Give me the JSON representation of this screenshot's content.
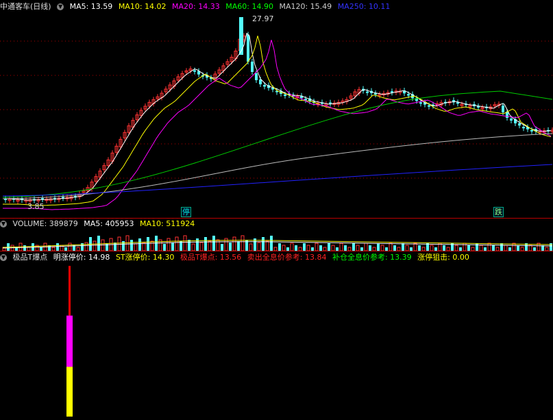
{
  "main": {
    "title": "中通客车(日线)",
    "ma": [
      {
        "label": "MA5: 13.59",
        "color": "#ffffff"
      },
      {
        "label": "MA10: 14.02",
        "color": "#ffff00"
      },
      {
        "label": "MA20: 14.33",
        "color": "#ff00ff"
      },
      {
        "label": "MA60: 14.90",
        "color": "#00ff00"
      },
      {
        "label": "MA120: 15.49",
        "color": "#cccccc"
      },
      {
        "label": "MA250: 10.11",
        "color": "#3333ff"
      }
    ],
    "high_label": "27.97",
    "low_label": "3.85",
    "badge_ting": "停",
    "badge_die": "跌"
  },
  "volume": {
    "title": "VOLUME: 389879",
    "ma5": "MA5: 405953",
    "ma10": "MA10: 511924"
  },
  "indicator": {
    "name": "极品T爆点",
    "items": [
      {
        "label": "明涨停价: 14.98",
        "color": "#ffffff"
      },
      {
        "label": "ST涨停价: 14.30",
        "color": "#ffff00"
      },
      {
        "label": "极品T爆点: 13.56",
        "color": "#ff2020"
      },
      {
        "label": "卖出全息价参考: 13.84",
        "color": "#ff2020"
      },
      {
        "label": "补仓全息价参考: 13.39",
        "color": "#00ff00"
      },
      {
        "label": "涨停狙击: 0.00",
        "color": "#ffff00"
      }
    ],
    "bar_levels": {
      "red": 1.0,
      "magenta": 0.67,
      "yellow": 0.33
    }
  },
  "colors": {
    "up": "#ff3333",
    "down": "#54ffff",
    "grid": "#b00000"
  }
}
